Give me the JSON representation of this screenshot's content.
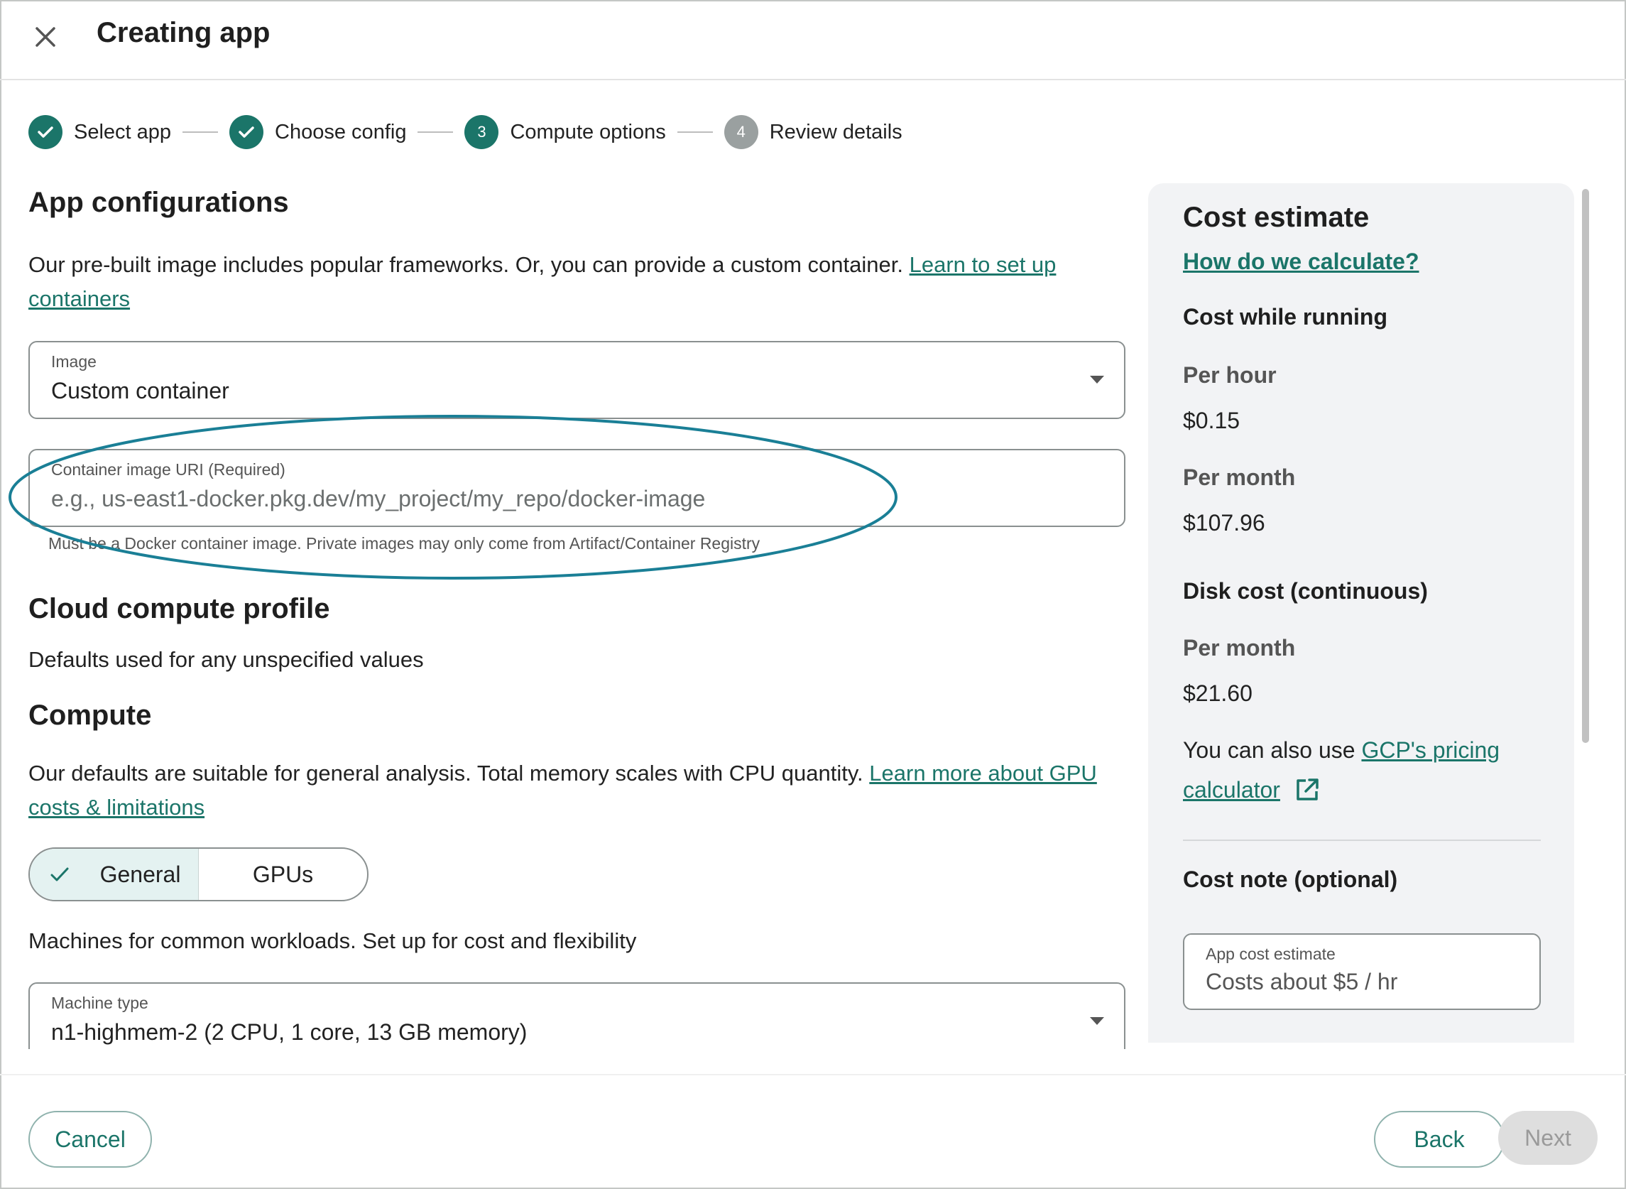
{
  "header": {
    "title": "Creating app",
    "close_icon": "close-icon"
  },
  "stepper": {
    "steps": [
      {
        "label": "Select app",
        "state": "done",
        "marker": ""
      },
      {
        "label": "Choose config",
        "state": "done",
        "marker": ""
      },
      {
        "label": "Compute options",
        "state": "active",
        "marker": "3"
      },
      {
        "label": "Review details",
        "state": "pending",
        "marker": "4"
      }
    ]
  },
  "app_config": {
    "heading": "App configurations",
    "description": "Our pre-built image includes popular frameworks. Or, you can provide a custom container. ",
    "learn_link": "Learn to set up containers",
    "image_field": {
      "label": "Image",
      "value": "Custom container"
    },
    "uri_field": {
      "label": "Container image URI (Required)",
      "placeholder": "e.g., us-east1-docker.pkg.dev/my_project/my_repo/docker-image",
      "helper": "Must be a Docker container image. Private images may only come from Artifact/Container Registry"
    }
  },
  "cloud_profile": {
    "heading": "Cloud compute profile",
    "description": "Defaults used for any unspecified values"
  },
  "compute": {
    "heading": "Compute",
    "description": "Our defaults are suitable for general analysis. Total memory scales with CPU quantity. ",
    "learn_link": "Learn more about GPU costs & limitations",
    "toggle": {
      "general": "General",
      "gpus": "GPUs",
      "selected": "General"
    },
    "machines_text": "Machines for common workloads. Set up for cost and flexibility",
    "machine_field": {
      "label": "Machine type",
      "value": "n1-highmem-2 (2 CPU, 1 core, 13 GB memory)"
    }
  },
  "cost": {
    "heading": "Cost estimate",
    "how_link": "How do we calculate?",
    "running_heading": "Cost while running",
    "per_hour_label": "Per hour",
    "per_hour_value": "$0.15",
    "per_month_label": "Per month",
    "per_month_value": "$107.96",
    "disk_heading": "Disk cost (continuous)",
    "disk_month_label": "Per month",
    "disk_month_value": "$21.60",
    "also_text": "You can also use ",
    "gcp_link": "GCP's pricing calculator",
    "note_heading": "Cost note (optional)",
    "note_field": {
      "label": "App cost estimate",
      "value": "Costs about $5 / hr"
    }
  },
  "footer": {
    "cancel": "Cancel",
    "back": "Back",
    "next": "Next"
  },
  "colors": {
    "accent": "#1b7569",
    "annotation": "#1a7f96",
    "panel": "#f2f3f5"
  }
}
